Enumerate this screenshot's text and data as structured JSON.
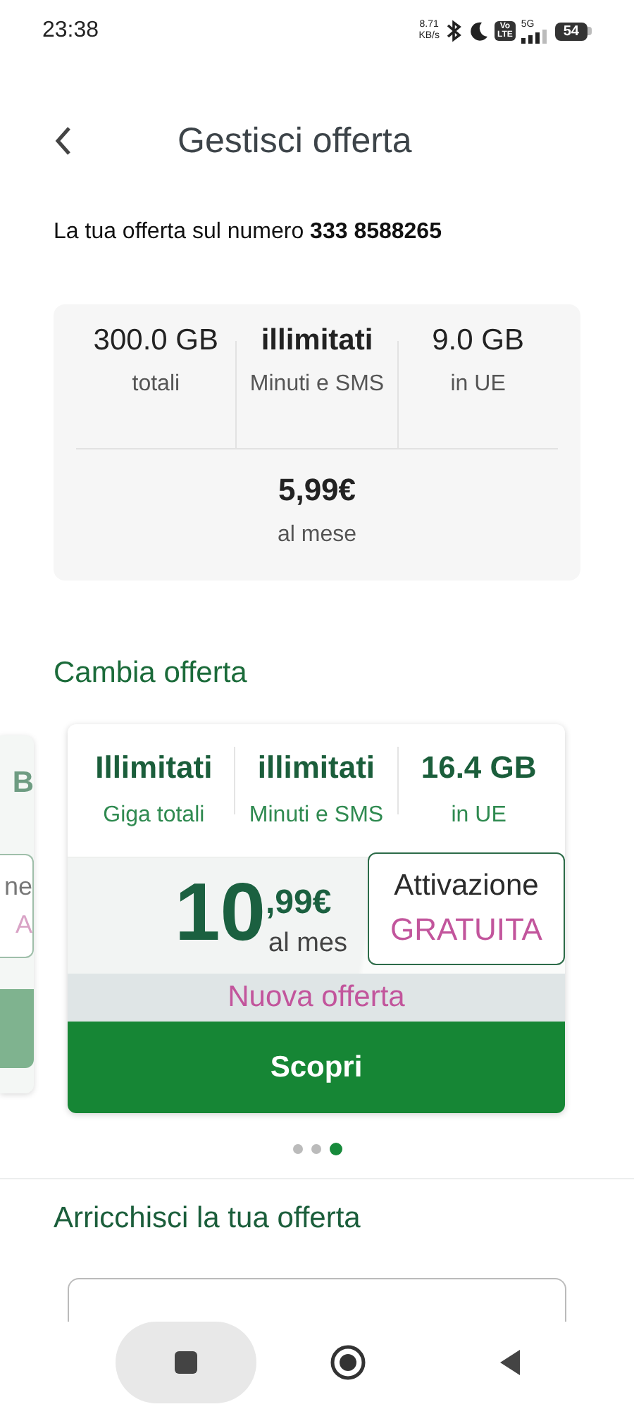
{
  "status_bar": {
    "time": "23:38",
    "net_speed": "8.71",
    "net_unit": "KB/s",
    "volte": [
      "Vo",
      "LTE"
    ],
    "network": "5G",
    "battery": "54"
  },
  "header": {
    "title": "Gestisci offerta"
  },
  "intro": {
    "text": "La tua offerta sul numero **333 8588265**"
  },
  "current_plan": {
    "stats": [
      {
        "value": "300.0 GB",
        "label": "totali"
      },
      {
        "value": "illimitati",
        "label": "Minuti e SMS"
      },
      {
        "value": "9.0 GB",
        "label": "in UE"
      }
    ],
    "price": "5,99€",
    "period": "al mese"
  },
  "change_offer": {
    "title": "Cambia offerta",
    "peek_card": {
      "value": "B",
      "badge_top": "ne",
      "badge_bottom": "A"
    },
    "card": {
      "stats": [
        {
          "value": "Illimitati",
          "label": "Giga totali"
        },
        {
          "value": "illimitati",
          "label": "Minuti e SMS"
        },
        {
          "value": "16.4 GB",
          "label": "in UE"
        }
      ],
      "price_int": "10",
      "price_dec": ",99€",
      "period": "al mes",
      "badge": {
        "line1": "Attivazione",
        "line2": "GRATUITA"
      },
      "ribbon": "Nuova offerta",
      "button": "Scopri"
    },
    "pages": [
      {
        "selected": false
      },
      {
        "selected": false
      },
      {
        "selected": true
      }
    ]
  },
  "enrich": {
    "title": "Arricchisci la tua offerta"
  },
  "nav_bar": {
    "buttons": [
      {
        "kind": "recents"
      },
      {
        "kind": "home"
      },
      {
        "kind": "back"
      }
    ]
  }
}
